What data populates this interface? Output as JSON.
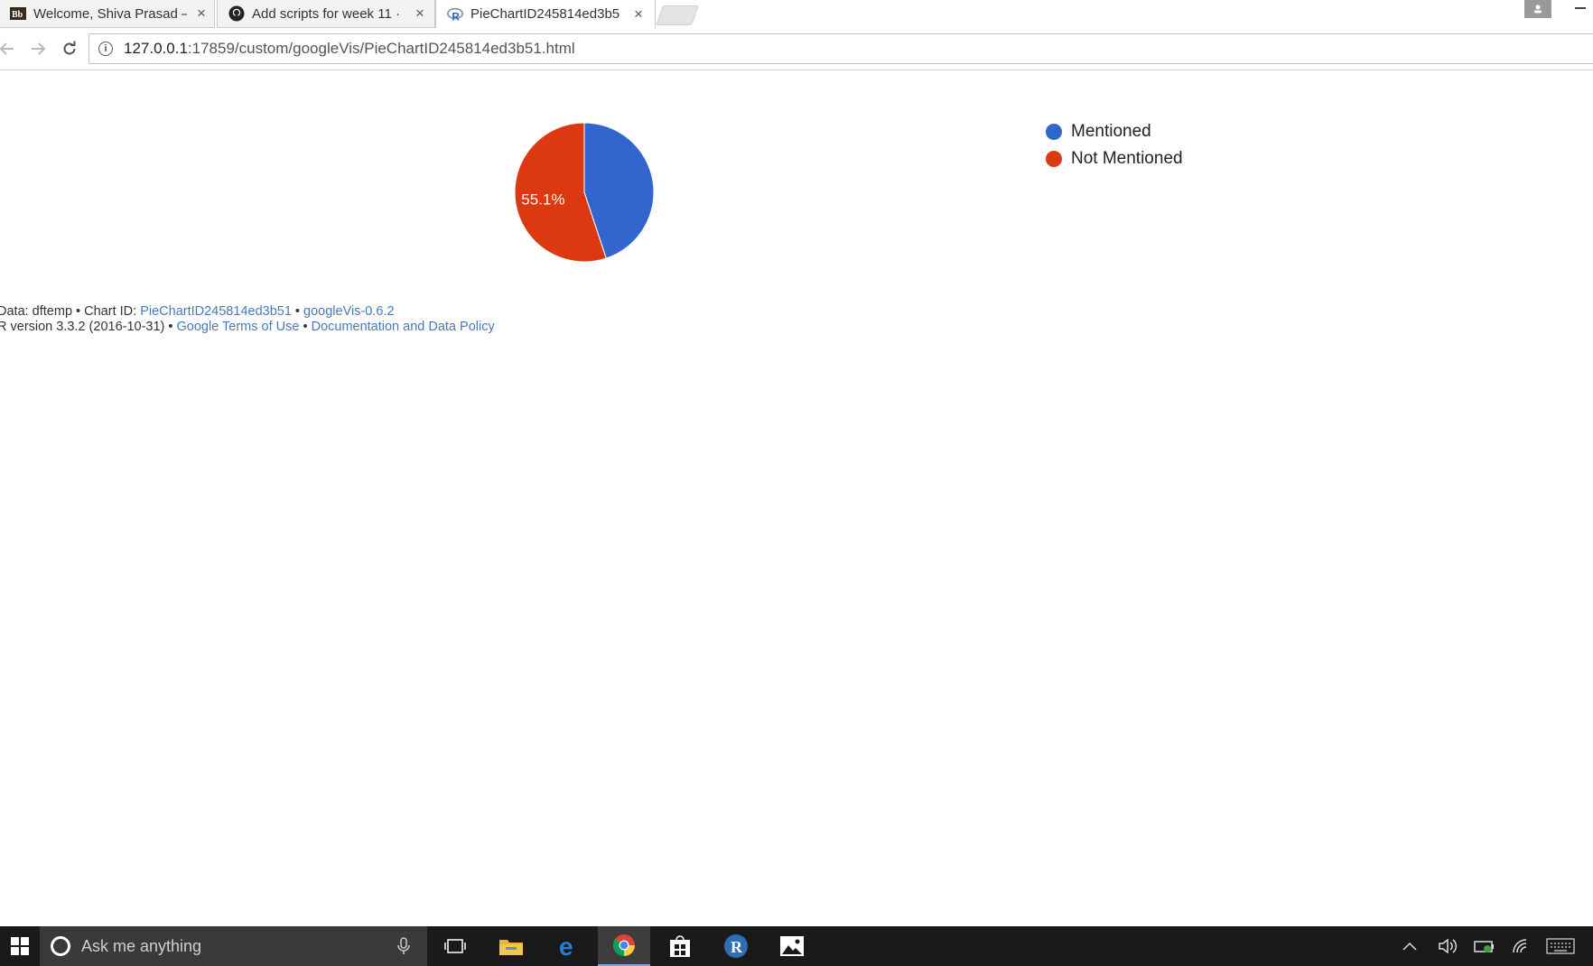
{
  "browser": {
    "tabs": [
      {
        "title": "Welcome, Shiva Prasad –",
        "favicon": "blackboard-bb-icon",
        "active": false
      },
      {
        "title": "Add scripts for week 11 ·",
        "favicon": "github-icon",
        "active": false
      },
      {
        "title": "PieChartID245814ed3b5",
        "favicon": "r-logo-icon",
        "active": true
      }
    ],
    "close_glyph": "×",
    "url_host": "127.0.0.1",
    "url_rest": ":17859/custom/googleVis/PieChartID245814ed3b51.html"
  },
  "chart_data": {
    "type": "pie",
    "categories": [
      "Mentioned",
      "Not Mentioned"
    ],
    "values": [
      44.9,
      55.1
    ],
    "colors": [
      "#3366cc",
      "#dc3912"
    ],
    "slice_labels": [
      "",
      "55.1%"
    ],
    "legend_position": "right"
  },
  "footer": {
    "line1_prefix": "Data: dftemp • Chart ID: ",
    "chart_id_link": "PieChartID245814ed3b51",
    "sep1": " • ",
    "version_link": "googleVis-0.6.2",
    "line2_prefix": "R version 3.3.2 (2016-10-31) • ",
    "terms_link": "Google Terms of Use",
    "sep2": " • ",
    "policy_link": "Documentation and Data Policy"
  },
  "taskbar": {
    "search_placeholder": "Ask me anything",
    "apps": [
      "task-view-icon",
      "file-explorer-icon",
      "edge-icon",
      "chrome-icon",
      "store-icon",
      "r-app-icon",
      "photos-icon"
    ],
    "tray": [
      "chevron-up-icon",
      "volume-icon",
      "battery-icon",
      "wifi-icon",
      "keyboard-icon"
    ]
  }
}
